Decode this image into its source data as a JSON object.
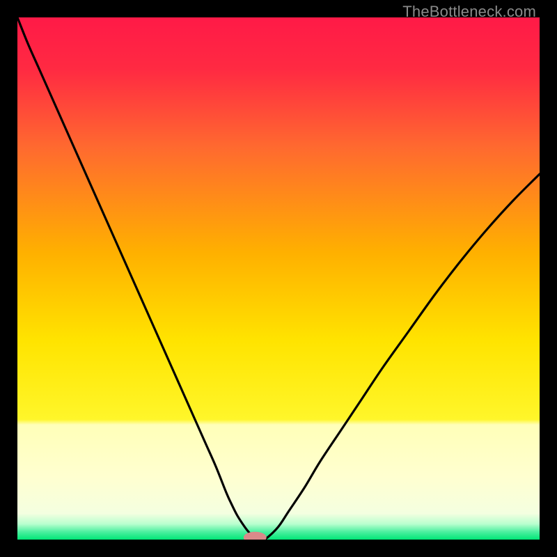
{
  "watermark": {
    "text": "TheBottleneck.com"
  },
  "chart_data": {
    "type": "line",
    "title": "",
    "xlabel": "",
    "ylabel": "",
    "xlim": [
      0,
      100
    ],
    "ylim": [
      0,
      100
    ],
    "grid": false,
    "legend": false,
    "background_gradient": {
      "top_color": "#ff1a47",
      "mid_color": "#ffd400",
      "bottom_color": "#00e676",
      "pale_band_start": 78,
      "pale_band_end": 97
    },
    "marker": {
      "x": 45.5,
      "y": 0,
      "color": "#d98a8a",
      "rx": 2.2,
      "ry": 1.1
    },
    "series": [
      {
        "name": "curve",
        "x": [
          0,
          2,
          4,
          6,
          8,
          10,
          12,
          14,
          16,
          18,
          20,
          22,
          24,
          26,
          28,
          30,
          32,
          34,
          36,
          38,
          40,
          41,
          42,
          43,
          44,
          45,
          46,
          47,
          48,
          50,
          52,
          55,
          58,
          62,
          66,
          70,
          75,
          80,
          85,
          90,
          95,
          100
        ],
        "y": [
          100,
          95,
          90.5,
          86,
          81.5,
          77,
          72.5,
          68,
          63.5,
          59,
          54.5,
          50,
          45.5,
          41,
          36.5,
          32,
          27.5,
          23,
          18.5,
          14,
          9,
          6.8,
          4.8,
          3.2,
          1.8,
          0.7,
          0.2,
          0,
          0.5,
          2.5,
          5.5,
          10,
          15,
          21,
          27,
          33,
          40,
          47,
          53.5,
          59.5,
          65,
          70
        ]
      }
    ]
  }
}
